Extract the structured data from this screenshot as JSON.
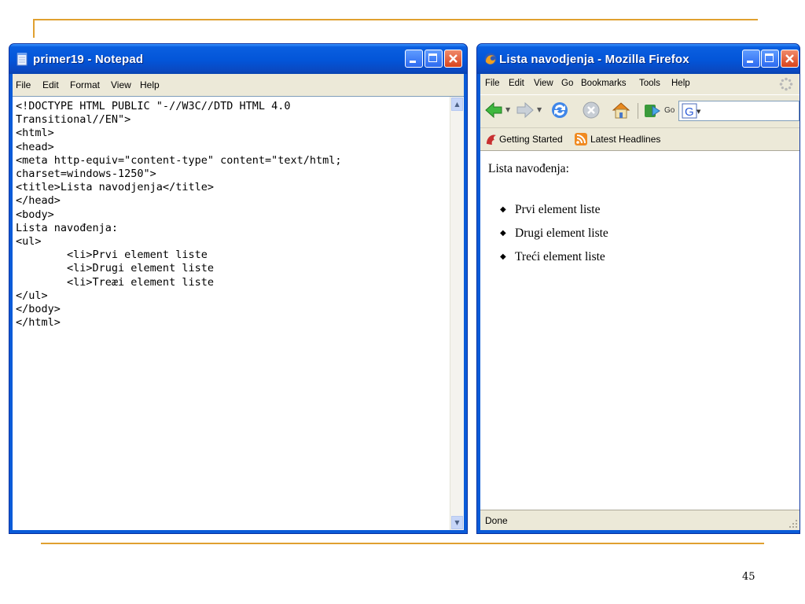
{
  "slide": {
    "page_number": "45"
  },
  "notepad": {
    "title": "primer19 - Notepad",
    "menu": [
      "File",
      "Edit",
      "Format",
      "View",
      "Help"
    ],
    "code": "<!DOCTYPE HTML PUBLIC \"-//W3C//DTD HTML 4.0\nTransitional//EN\">\n<html>\n<head>\n<meta http-equiv=\"content-type\" content=\"text/html;\ncharset=windows-1250\">\n<title>Lista navodjenja</title>\n</head>\n<body>\nLista navođenja:\n<ul>\n        <li>Prvi element liste\n        <li>Drugi element liste\n        <li>Treæi element liste\n</ul>\n</body>\n</html>"
  },
  "firefox": {
    "title": "Lista navodjenja - Mozilla Firefox",
    "menu": [
      "File",
      "Edit",
      "View",
      "Go",
      "Bookmarks",
      "Tools",
      "Help"
    ],
    "go_label": "Go",
    "bookmarks": [
      "Getting Started",
      "Latest Headlines"
    ],
    "page": {
      "heading": "Lista navođenja:",
      "items": [
        "Prvi element liste",
        "Drugi element liste",
        "Treći element liste"
      ]
    },
    "status": "Done"
  },
  "colors": {
    "accent_line": "#e0a030",
    "xp_title_blue": "#0355d8",
    "xp_face": "#ece9d8"
  }
}
